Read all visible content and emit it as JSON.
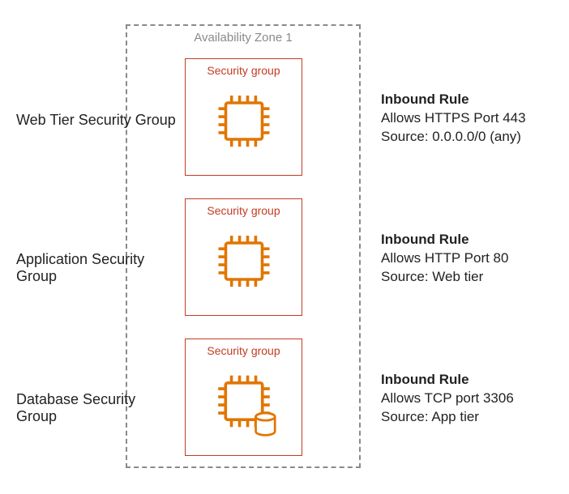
{
  "zone_label": "Availability Zone 1",
  "colors": {
    "sg_border": "#c23b22",
    "icon_orange": "#e27500",
    "az_border": "#8a8a8a"
  },
  "tiers": [
    {
      "name": "Web Tier Security Group",
      "sg_caption": "Security group",
      "rule_heading": "Inbound Rule",
      "rule_line1": "Allows HTTPS Port 443",
      "rule_line2": "Source: 0.0.0.0/0 (any)"
    },
    {
      "name": "Application Security Group",
      "sg_caption": "Security group",
      "rule_heading": "Inbound Rule",
      "rule_line1": "Allows HTTP Port 80",
      "rule_line2": "Source: Web tier"
    },
    {
      "name": "Database Security Group",
      "sg_caption": "Security group",
      "rule_heading": "Inbound Rule",
      "rule_line1": "Allows TCP port 3306",
      "rule_line2": "Source: App tier"
    }
  ]
}
